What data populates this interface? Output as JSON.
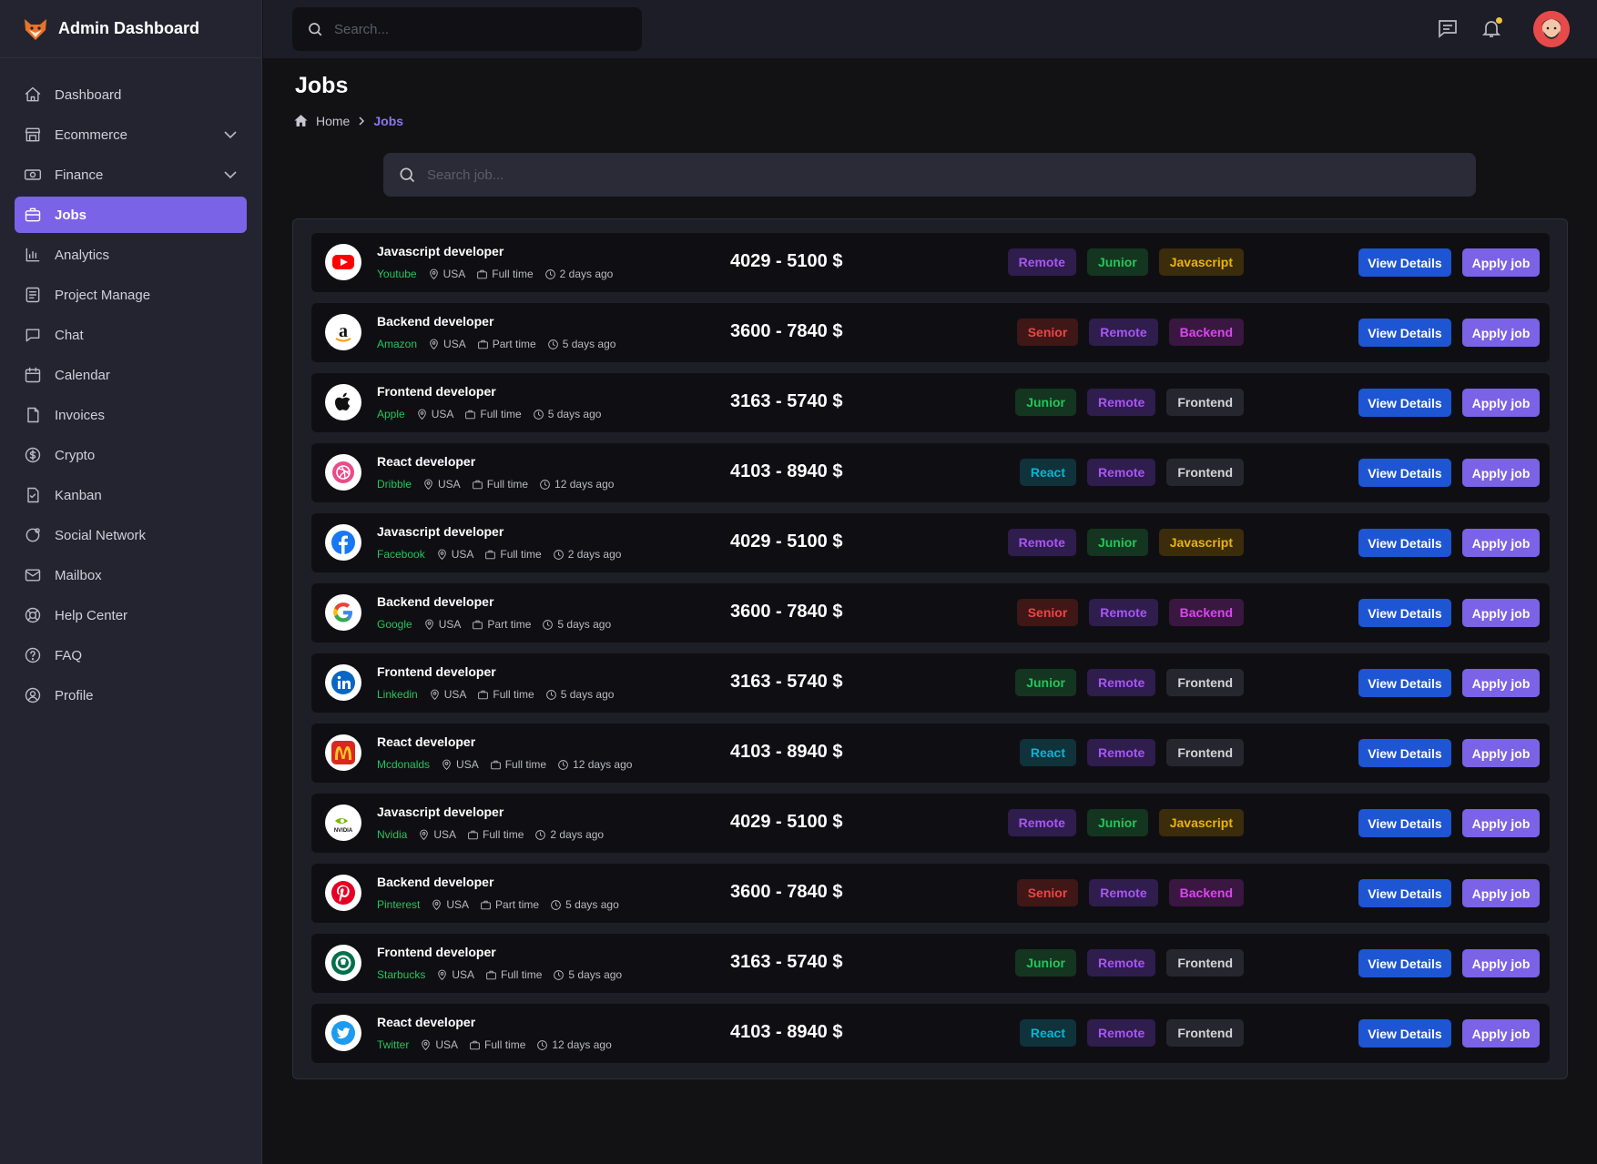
{
  "app": {
    "title": "Admin Dashboard"
  },
  "topbar": {
    "search_placeholder": "Search..."
  },
  "sidebar": {
    "items": [
      {
        "label": "Dashboard",
        "icon": "home-icon"
      },
      {
        "label": "Ecommerce",
        "icon": "store-icon",
        "expandable": true
      },
      {
        "label": "Finance",
        "icon": "money-icon",
        "expandable": true
      },
      {
        "label": "Jobs",
        "icon": "briefcase-icon",
        "active": true
      },
      {
        "label": "Analytics",
        "icon": "chart-icon"
      },
      {
        "label": "Project Manage",
        "icon": "project-icon"
      },
      {
        "label": "Chat",
        "icon": "chat-icon"
      },
      {
        "label": "Calendar",
        "icon": "calendar-icon"
      },
      {
        "label": "Invoices",
        "icon": "invoice-icon"
      },
      {
        "label": "Crypto",
        "icon": "dollar-icon"
      },
      {
        "label": "Kanban",
        "icon": "kanban-icon"
      },
      {
        "label": "Social Network",
        "icon": "social-icon"
      },
      {
        "label": "Mailbox",
        "icon": "mail-icon"
      },
      {
        "label": "Help Center",
        "icon": "lifebuoy-icon"
      },
      {
        "label": "FAQ",
        "icon": "question-icon"
      },
      {
        "label": "Profile",
        "icon": "user-icon"
      }
    ]
  },
  "page": {
    "title": "Jobs",
    "breadcrumb": {
      "home": "Home",
      "current": "Jobs"
    },
    "job_search_placeholder": "Search job..."
  },
  "tag_styles": {
    "Remote": {
      "bg": "#2f1d4d",
      "fg": "#a855f7"
    },
    "Junior": {
      "bg": "#14351f",
      "fg": "#22c55e"
    },
    "Javascript": {
      "bg": "#3b2d0c",
      "fg": "#eab308"
    },
    "Senior": {
      "bg": "#3f1717",
      "fg": "#ef4444"
    },
    "Backend": {
      "bg": "#3a1740",
      "fg": "#d946ef"
    },
    "Frontend": {
      "bg": "#26272e",
      "fg": "#d4d4d8"
    },
    "React": {
      "bg": "#10323a",
      "fg": "#06b6d4"
    }
  },
  "buttons": {
    "view": "View Details",
    "apply": "Apply job"
  },
  "jobs": [
    {
      "title": "Javascript developer",
      "company": "Youtube",
      "location": "USA",
      "type": "Full time",
      "posted": "2 days ago",
      "salary": "4029 - 5100 $",
      "tags": [
        "Remote",
        "Junior",
        "Javascript"
      ],
      "logo": "youtube-logo"
    },
    {
      "title": "Backend developer",
      "company": "Amazon",
      "location": "USA",
      "type": "Part time",
      "posted": "5 days ago",
      "salary": "3600 - 7840 $",
      "tags": [
        "Senior",
        "Remote",
        "Backend"
      ],
      "logo": "amazon-logo"
    },
    {
      "title": "Frontend developer",
      "company": "Apple",
      "location": "USA",
      "type": "Full time",
      "posted": "5 days ago",
      "salary": "3163 - 5740 $",
      "tags": [
        "Junior",
        "Remote",
        "Frontend"
      ],
      "logo": "apple-logo"
    },
    {
      "title": "React developer",
      "company": "Dribble",
      "location": "USA",
      "type": "Full time",
      "posted": "12 days ago",
      "salary": "4103 - 8940 $",
      "tags": [
        "React",
        "Remote",
        "Frontend"
      ],
      "logo": "dribbble-logo"
    },
    {
      "title": "Javascript developer",
      "company": "Facebook",
      "location": "USA",
      "type": "Full time",
      "posted": "2 days ago",
      "salary": "4029 - 5100 $",
      "tags": [
        "Remote",
        "Junior",
        "Javascript"
      ],
      "logo": "facebook-logo"
    },
    {
      "title": "Backend developer",
      "company": "Google",
      "location": "USA",
      "type": "Part time",
      "posted": "5 days ago",
      "salary": "3600 - 7840 $",
      "tags": [
        "Senior",
        "Remote",
        "Backend"
      ],
      "logo": "google-logo"
    },
    {
      "title": "Frontend developer",
      "company": "Linkedin",
      "location": "USA",
      "type": "Full time",
      "posted": "5 days ago",
      "salary": "3163 - 5740 $",
      "tags": [
        "Junior",
        "Remote",
        "Frontend"
      ],
      "logo": "linkedin-logo"
    },
    {
      "title": "React developer",
      "company": "Mcdonalds",
      "location": "USA",
      "type": "Full time",
      "posted": "12 days ago",
      "salary": "4103 - 8940 $",
      "tags": [
        "React",
        "Remote",
        "Frontend"
      ],
      "logo": "mcdonalds-logo"
    },
    {
      "title": "Javascript developer",
      "company": "Nvidia",
      "location": "USA",
      "type": "Full time",
      "posted": "2 days ago",
      "salary": "4029 - 5100 $",
      "tags": [
        "Remote",
        "Junior",
        "Javascript"
      ],
      "logo": "nvidia-logo"
    },
    {
      "title": "Backend developer",
      "company": "Pinterest",
      "location": "USA",
      "type": "Part time",
      "posted": "5 days ago",
      "salary": "3600 - 7840 $",
      "tags": [
        "Senior",
        "Remote",
        "Backend"
      ],
      "logo": "pinterest-logo"
    },
    {
      "title": "Frontend developer",
      "company": "Starbucks",
      "location": "USA",
      "type": "Full time",
      "posted": "5 days ago",
      "salary": "3163 - 5740 $",
      "tags": [
        "Junior",
        "Remote",
        "Frontend"
      ],
      "logo": "starbucks-logo"
    },
    {
      "title": "React developer",
      "company": "Twitter",
      "location": "USA",
      "type": "Full time",
      "posted": "12 days ago",
      "salary": "4103 - 8940 $",
      "tags": [
        "React",
        "Remote",
        "Frontend"
      ],
      "logo": "twitter-logo"
    }
  ]
}
